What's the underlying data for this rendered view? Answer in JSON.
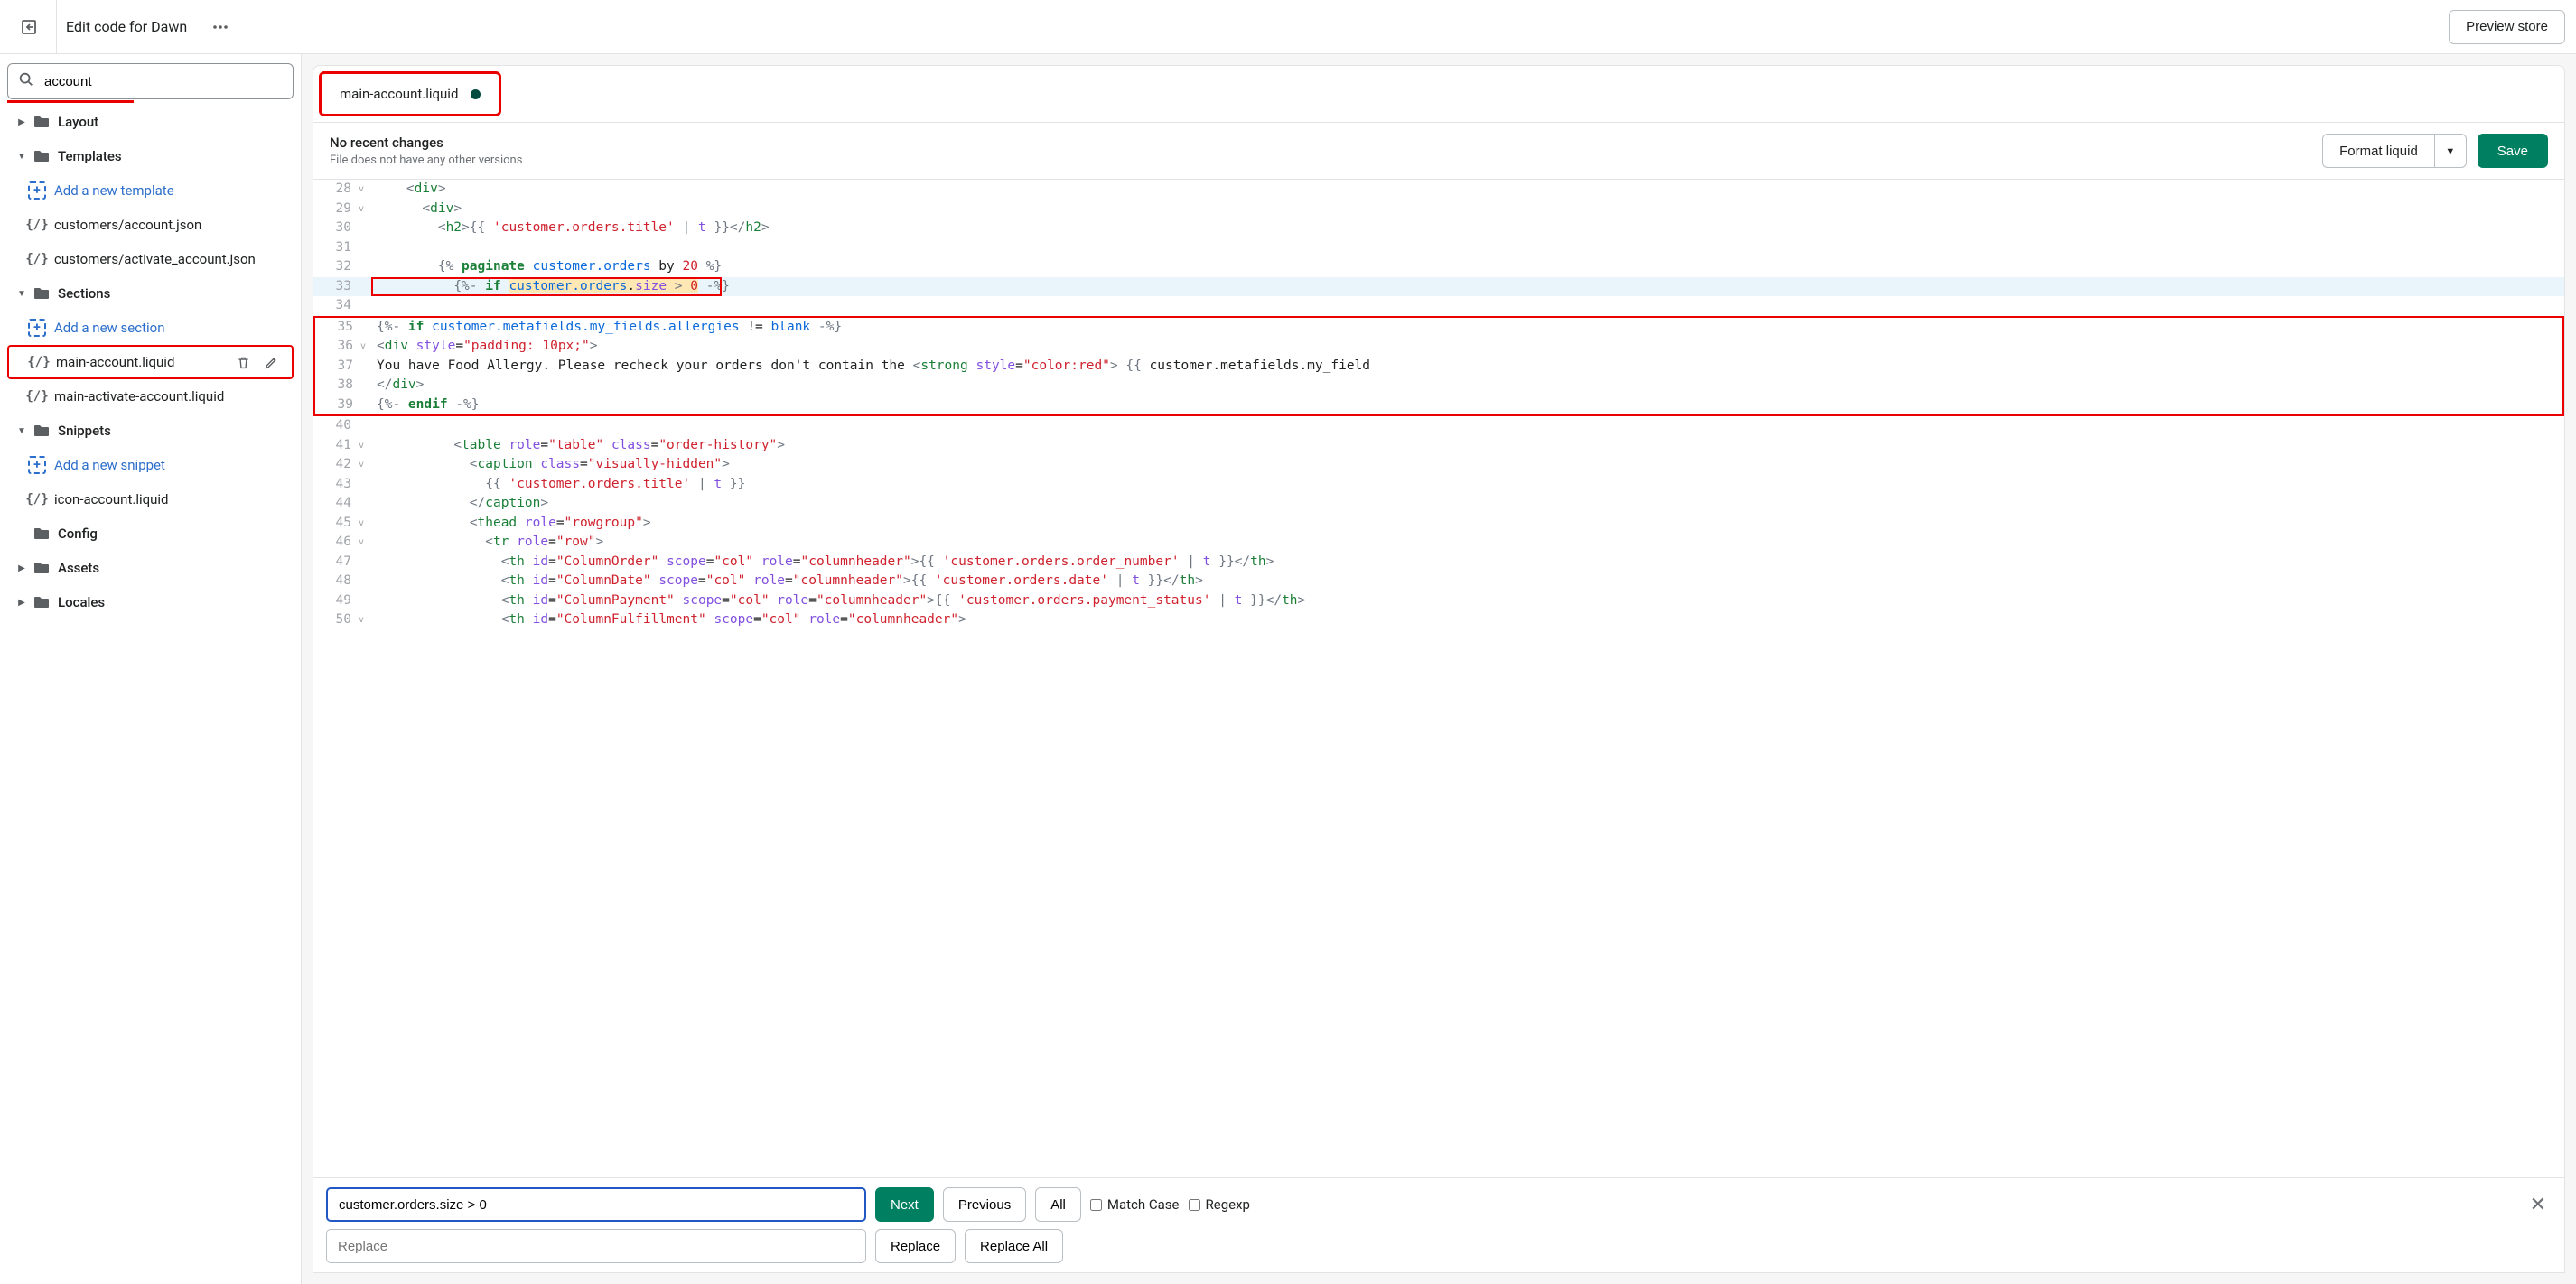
{
  "header": {
    "title": "Edit code for Dawn",
    "preview_label": "Preview store"
  },
  "sidebar": {
    "search_value": "account",
    "folders": {
      "layout": "Layout",
      "templates": "Templates",
      "sections": "Sections",
      "snippets": "Snippets",
      "config": "Config",
      "assets": "Assets",
      "locales": "Locales"
    },
    "add_labels": {
      "template": "Add a new template",
      "section": "Add a new section",
      "snippet": "Add a new snippet"
    },
    "files": {
      "cust_account": "customers/account.json",
      "cust_activate": "customers/activate_account.json",
      "main_account": "main-account.liquid",
      "main_activate": "main-activate-account.liquid",
      "icon_account": "icon-account.liquid"
    }
  },
  "tab": {
    "label": "main-account.liquid"
  },
  "status": {
    "title": "No recent changes",
    "subtitle": "File does not have any other versions",
    "format_label": "Format liquid",
    "save_label": "Save"
  },
  "code": {
    "lines": [
      {
        "n": 28,
        "fold": "v",
        "html": "    <span class='t-delim'>&lt;</span><span class='t-tag'>div</span><span class='t-delim'>&gt;</span>"
      },
      {
        "n": 29,
        "fold": "v",
        "html": "      <span class='t-delim'>&lt;</span><span class='t-tag'>div</span><span class='t-delim'>&gt;</span>"
      },
      {
        "n": 30,
        "fold": "",
        "html": "        <span class='t-delim'>&lt;</span><span class='t-tag'>h2</span><span class='t-delim'>&gt;</span><span class='t-delim'>{{ </span><span class='t-str'>'customer.orders.title'</span> <span class='t-op'>|</span> <span class='t-filter'>t</span> <span class='t-delim'>}}</span><span class='t-delim'>&lt;/</span><span class='t-tag'>h2</span><span class='t-delim'>&gt;</span>"
      },
      {
        "n": 31,
        "fold": "",
        "html": ""
      },
      {
        "n": 32,
        "fold": "",
        "html": "        <span class='t-delim'>{% </span><span class='t-kw'>paginate</span> <span class='t-fn'>customer.orders</span> by <span class='t-num'>20</span> <span class='t-delim'>%}</span>"
      },
      {
        "n": 33,
        "fold": "",
        "hl": true,
        "box33": true,
        "html": "          <span class='t-delim'>{%- </span><span class='t-kw'>if</span> <span class='sel-hl'><span class='t-fn'>customer.orders</span>.<span class='t-prop'>size</span> <span class='t-op'>&gt;</span> <span class='t-num'>0</span></span> <span class='t-delim'>-%}</span>"
      },
      {
        "n": 34,
        "fold": "",
        "html": ""
      },
      {
        "n": 35,
        "fold": "",
        "blockstart": true,
        "html": "<span class='t-delim'>{%- </span><span class='t-kw'>if</span> <span class='t-fn'>customer.metafields.my_fields.allergies</span> != <span class='t-fn'>blank</span> <span class='t-delim'>-%}</span>"
      },
      {
        "n": 36,
        "fold": "v",
        "html": "<span class='t-delim'>&lt;</span><span class='t-tag'>div</span> <span class='t-attr'>style</span>=<span class='t-str'>\"padding: 10px;\"</span><span class='t-delim'>&gt;</span>"
      },
      {
        "n": 37,
        "fold": "",
        "html": "You have Food Allergy. Please recheck your orders don't contain the <span class='t-delim'>&lt;</span><span class='t-tag'>strong</span> <span class='t-attr'>style</span>=<span class='t-str'>\"color:red\"</span><span class='t-delim'>&gt;</span> <span class='t-delim'>{{ </span>customer.metafields.my_field"
      },
      {
        "n": 38,
        "fold": "",
        "html": "<span class='t-delim'>&lt;/</span><span class='t-tag'>div</span><span class='t-delim'>&gt;</span>"
      },
      {
        "n": 39,
        "fold": "",
        "blockend": true,
        "html": "<span class='t-delim'>{%- </span><span class='t-kw'>endif</span> <span class='t-delim'>-%}</span>"
      },
      {
        "n": 40,
        "fold": "",
        "html": ""
      },
      {
        "n": 41,
        "fold": "v",
        "html": "          <span class='t-delim'>&lt;</span><span class='t-tag'>table</span> <span class='t-attr'>role</span>=<span class='t-str'>\"table\"</span> <span class='t-attr'>class</span>=<span class='t-str'>\"order-history\"</span><span class='t-delim'>&gt;</span>"
      },
      {
        "n": 42,
        "fold": "v",
        "html": "            <span class='t-delim'>&lt;</span><span class='t-tag'>caption</span> <span class='t-attr'>class</span>=<span class='t-str'>\"visually-hidden\"</span><span class='t-delim'>&gt;</span>"
      },
      {
        "n": 43,
        "fold": "",
        "html": "              <span class='t-delim'>{{ </span><span class='t-str'>'customer.orders.title'</span> <span class='t-op'>|</span> <span class='t-filter'>t</span> <span class='t-delim'>}}</span>"
      },
      {
        "n": 44,
        "fold": "",
        "html": "            <span class='t-delim'>&lt;/</span><span class='t-tag'>caption</span><span class='t-delim'>&gt;</span>"
      },
      {
        "n": 45,
        "fold": "v",
        "html": "            <span class='t-delim'>&lt;</span><span class='t-tag'>thead</span> <span class='t-attr'>role</span>=<span class='t-str'>\"rowgroup\"</span><span class='t-delim'>&gt;</span>"
      },
      {
        "n": 46,
        "fold": "v",
        "html": "              <span class='t-delim'>&lt;</span><span class='t-tag'>tr</span> <span class='t-attr'>role</span>=<span class='t-str'>\"row\"</span><span class='t-delim'>&gt;</span>"
      },
      {
        "n": 47,
        "fold": "",
        "html": "                <span class='t-delim'>&lt;</span><span class='t-tag'>th</span> <span class='t-attr'>id</span>=<span class='t-str'>\"ColumnOrder\"</span> <span class='t-attr'>scope</span>=<span class='t-str'>\"col\"</span> <span class='t-attr'>role</span>=<span class='t-str'>\"columnheader\"</span><span class='t-delim'>&gt;</span><span class='t-delim'>{{ </span><span class='t-str'>'customer.orders.order_number'</span> <span class='t-op'>|</span> <span class='t-filter'>t</span> <span class='t-delim'>}}</span><span class='t-delim'>&lt;/</span><span class='t-tag'>th</span><span class='t-delim'>&gt;</span>"
      },
      {
        "n": 48,
        "fold": "",
        "html": "                <span class='t-delim'>&lt;</span><span class='t-tag'>th</span> <span class='t-attr'>id</span>=<span class='t-str'>\"ColumnDate\"</span> <span class='t-attr'>scope</span>=<span class='t-str'>\"col\"</span> <span class='t-attr'>role</span>=<span class='t-str'>\"columnheader\"</span><span class='t-delim'>&gt;</span><span class='t-delim'>{{ </span><span class='t-str'>'customer.orders.date'</span> <span class='t-op'>|</span> <span class='t-filter'>t</span> <span class='t-delim'>}}</span><span class='t-delim'>&lt;/</span><span class='t-tag'>th</span><span class='t-delim'>&gt;</span>"
      },
      {
        "n": 49,
        "fold": "",
        "html": "                <span class='t-delim'>&lt;</span><span class='t-tag'>th</span> <span class='t-attr'>id</span>=<span class='t-str'>\"ColumnPayment\"</span> <span class='t-attr'>scope</span>=<span class='t-str'>\"col\"</span> <span class='t-attr'>role</span>=<span class='t-str'>\"columnheader\"</span><span class='t-delim'>&gt;</span><span class='t-delim'>{{ </span><span class='t-str'>'customer.orders.payment_status'</span> <span class='t-op'>|</span> <span class='t-filter'>t</span> <span class='t-delim'>}}</span><span class='t-delim'>&lt;/</span><span class='t-tag'>th</span><span class='t-delim'>&gt;</span>"
      },
      {
        "n": 50,
        "fold": "v",
        "html": "                <span class='t-delim'>&lt;</span><span class='t-tag'>th</span> <span class='t-attr'>id</span>=<span class='t-str'>\"ColumnFulfillment\"</span> <span class='t-attr'>scope</span>=<span class='t-str'>\"col\"</span> <span class='t-attr'>role</span>=<span class='t-str'>\"columnheader\"</span><span class='t-delim'>&gt;</span>"
      }
    ]
  },
  "find": {
    "find_value": "customer.orders.size > 0",
    "replace_placeholder": "Replace",
    "next_label": "Next",
    "previous_label": "Previous",
    "all_label": "All",
    "match_case_label": "Match Case",
    "regexp_label": "Regexp",
    "replace_label": "Replace",
    "replace_all_label": "Replace All"
  }
}
